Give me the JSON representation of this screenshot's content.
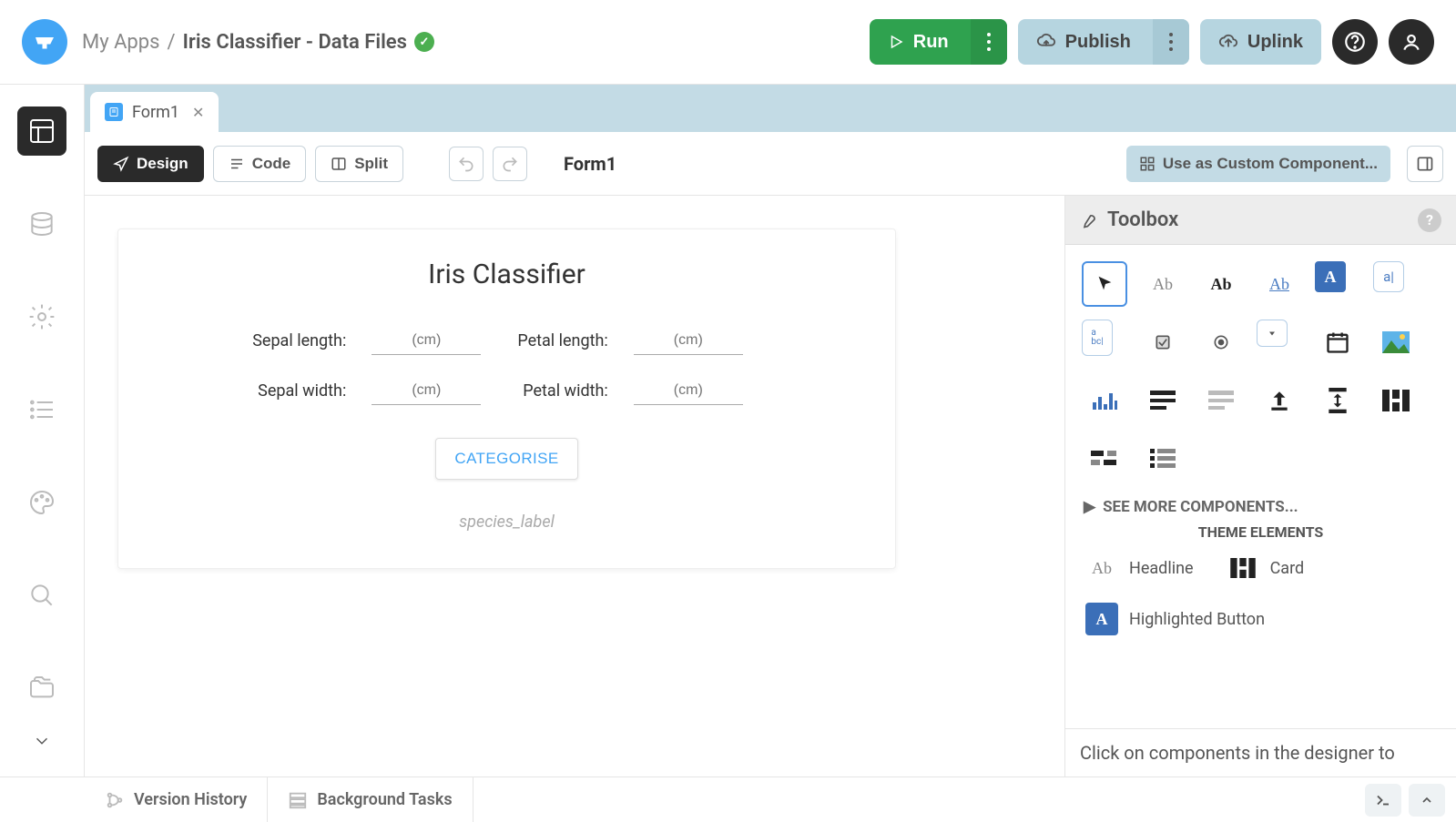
{
  "header": {
    "breadcrumb_root": "My Apps",
    "breadcrumb_sep": "/",
    "app_name": "Iris Classifier - Data Files",
    "run": "Run",
    "publish": "Publish",
    "uplink": "Uplink"
  },
  "tab": {
    "name": "Form1"
  },
  "toolbar": {
    "design": "Design",
    "code": "Code",
    "split": "Split",
    "form_name": "Form1",
    "custom_component": "Use as Custom Component..."
  },
  "form": {
    "title": "Iris Classifier",
    "sepal_length_label": "Sepal length:",
    "sepal_width_label": "Sepal width:",
    "petal_length_label": "Petal length:",
    "petal_width_label": "Petal width:",
    "placeholder_cm": "(cm)",
    "categorise": "CATEGORISE",
    "species_label": "species_label"
  },
  "toolbox": {
    "title": "Toolbox",
    "see_more": "SEE MORE COMPONENTS...",
    "theme_title": "THEME ELEMENTS",
    "theme_items": {
      "headline": "Headline",
      "card": "Card",
      "highlighted_button": "Highlighted Button"
    },
    "footer_hint": "Click on components in the designer to"
  },
  "bottom": {
    "version_history": "Version History",
    "background_tasks": "Background Tasks"
  }
}
